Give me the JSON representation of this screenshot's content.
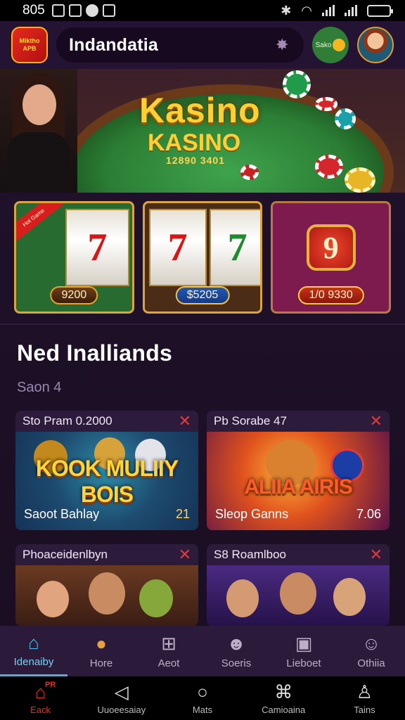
{
  "status_bar": {
    "time": "805"
  },
  "header": {
    "logo_text": "Miktho APB",
    "title": "Indandatia",
    "coin_text": "Sako"
  },
  "hero": {
    "title": "Kasino",
    "subtitle": "KASINO",
    "number": "12890 3401"
  },
  "slots": [
    {
      "ribbon": "Hot Game",
      "reel_symbols": [
        "7"
      ],
      "price": "9200"
    },
    {
      "reel_symbols": [
        "7",
        "7"
      ],
      "price": "$5205"
    },
    {
      "symbol": "9",
      "price": "1/0 9330"
    }
  ],
  "section": {
    "title": "Ned Inalliands",
    "subtitle": "Saon 4"
  },
  "games": [
    {
      "header": "Sto Pram 0.2000",
      "art_title": "KOOK MULIIY BOIS",
      "label": "Saoot Bahlay",
      "number": "21"
    },
    {
      "header": "Pb Sorabe 47",
      "art_title": "ALIIA AIRIS",
      "label": "Sleop Ganns",
      "number": "7.06"
    },
    {
      "header": "Phoaceidenlbyn",
      "label": ""
    },
    {
      "header": "S8 Roamlboo",
      "label": ""
    }
  ],
  "categories": [
    {
      "label": "Idenaiby",
      "icon": "home-icon",
      "active": true
    },
    {
      "label": "Hore",
      "icon": "person-icon",
      "active": false
    },
    {
      "label": "Aeot",
      "icon": "grid-icon",
      "active": false
    },
    {
      "label": "Soeris",
      "icon": "users-icon",
      "active": false
    },
    {
      "label": "Lieboet",
      "icon": "lock-icon",
      "active": false
    },
    {
      "label": "Othiia",
      "icon": "user-icon",
      "active": false
    }
  ],
  "system_nav": [
    {
      "label": "Eack",
      "icon": "home-icon",
      "badge": "PR",
      "active": true
    },
    {
      "label": "Uuoeesaiay",
      "icon": "back-icon",
      "active": false
    },
    {
      "label": "Mats",
      "icon": "circle-icon",
      "active": false
    },
    {
      "label": "Camioaina",
      "icon": "book-icon",
      "active": false
    },
    {
      "label": "Tains",
      "icon": "profile-icon",
      "active": false
    }
  ],
  "colors": {
    "background": "#1d1027",
    "accent_gold": "#ffd034",
    "accent_cyan": "#37b9e5",
    "close_red": "#e23a3a"
  }
}
